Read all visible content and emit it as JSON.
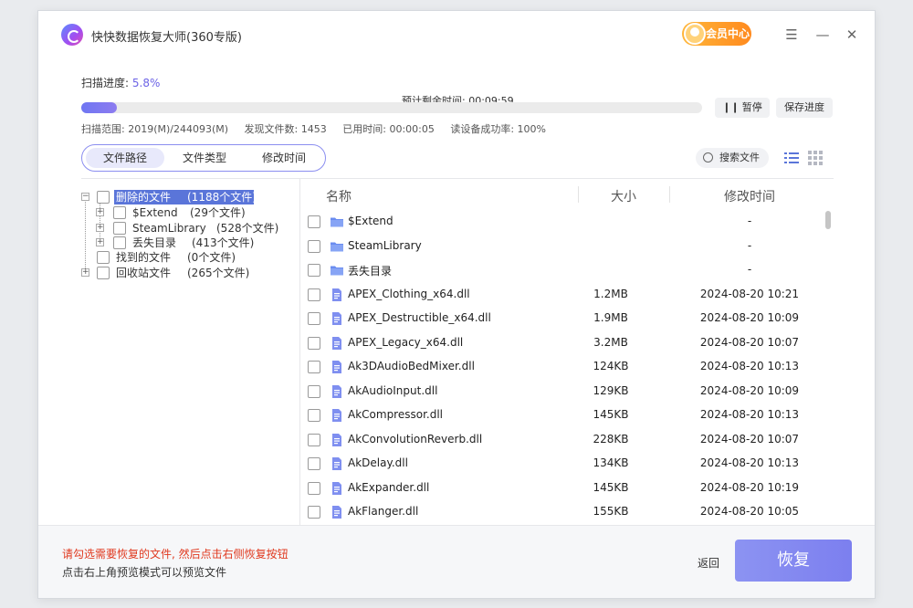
{
  "app": {
    "title": "快快数据恢复大师(360专版)",
    "vip_label": "会员中心"
  },
  "window_controls": {
    "menu": "☰",
    "minimize": "—",
    "close": "✕"
  },
  "scan": {
    "progress_label": "扫描进度:",
    "progress_value": "5.8%",
    "progress_fraction": 0.058,
    "remaining": "预计剩余时间: 00:09:59",
    "pause": "暂停",
    "save": "保存进度",
    "range": "扫描范围: 2019(M)/244093(M)",
    "found": "发现文件数: 1453",
    "elapsed": "已用时间: 00:00:05",
    "success": "读设备成功率: 100%"
  },
  "view_tabs": [
    "文件路径",
    "文件类型",
    "修改时间"
  ],
  "search_label": "搜索文件",
  "tree": [
    {
      "label": "删除的文件",
      "count": "(1188个文件)"
    },
    {
      "label": "$Extend",
      "count": "(29个文件)"
    },
    {
      "label": "SteamLibrary",
      "count": "(528个文件)"
    },
    {
      "label": "丢失目录",
      "count": "(413个文件)"
    },
    {
      "label": "找到的文件",
      "count": "(0个文件)"
    },
    {
      "label": "回收站文件",
      "count": "(265个文件)"
    }
  ],
  "table": {
    "headers": {
      "name": "名称",
      "size": "大小",
      "date": "修改时间"
    },
    "rows": [
      {
        "type": "folder",
        "name": "$Extend",
        "size": "",
        "date": "-"
      },
      {
        "type": "folder",
        "name": "SteamLibrary",
        "size": "",
        "date": "-"
      },
      {
        "type": "folder",
        "name": "丢失目录",
        "size": "",
        "date": "-"
      },
      {
        "type": "file",
        "name": "APEX_Clothing_x64.dll",
        "size": "1.2MB",
        "date": "2024-08-20 10:21"
      },
      {
        "type": "file",
        "name": "APEX_Destructible_x64.dll",
        "size": "1.9MB",
        "date": "2024-08-20 10:09"
      },
      {
        "type": "file",
        "name": "APEX_Legacy_x64.dll",
        "size": "3.2MB",
        "date": "2024-08-20 10:07"
      },
      {
        "type": "file",
        "name": "Ak3DAudioBedMixer.dll",
        "size": "124KB",
        "date": "2024-08-20 10:13"
      },
      {
        "type": "file",
        "name": "AkAudioInput.dll",
        "size": "129KB",
        "date": "2024-08-20 10:09"
      },
      {
        "type": "file",
        "name": "AkCompressor.dll",
        "size": "145KB",
        "date": "2024-08-20 10:13"
      },
      {
        "type": "file",
        "name": "AkConvolutionReverb.dll",
        "size": "228KB",
        "date": "2024-08-20 10:07"
      },
      {
        "type": "file",
        "name": "AkDelay.dll",
        "size": "134KB",
        "date": "2024-08-20 10:13"
      },
      {
        "type": "file",
        "name": "AkExpander.dll",
        "size": "145KB",
        "date": "2024-08-20 10:19"
      },
      {
        "type": "file",
        "name": "AkFlanger.dll",
        "size": "155KB",
        "date": "2024-08-20 10:05"
      }
    ]
  },
  "footer": {
    "hint1": "请勾选需要恢复的文件, 然后点击右侧恢复按钮",
    "hint2": "点击右上角预览模式可以预览文件",
    "back": "返回",
    "recover": "恢复"
  },
  "colors": {
    "accent": "#7c7fef",
    "warning": "#e0391f",
    "tree_selected": "#5a75d9"
  }
}
